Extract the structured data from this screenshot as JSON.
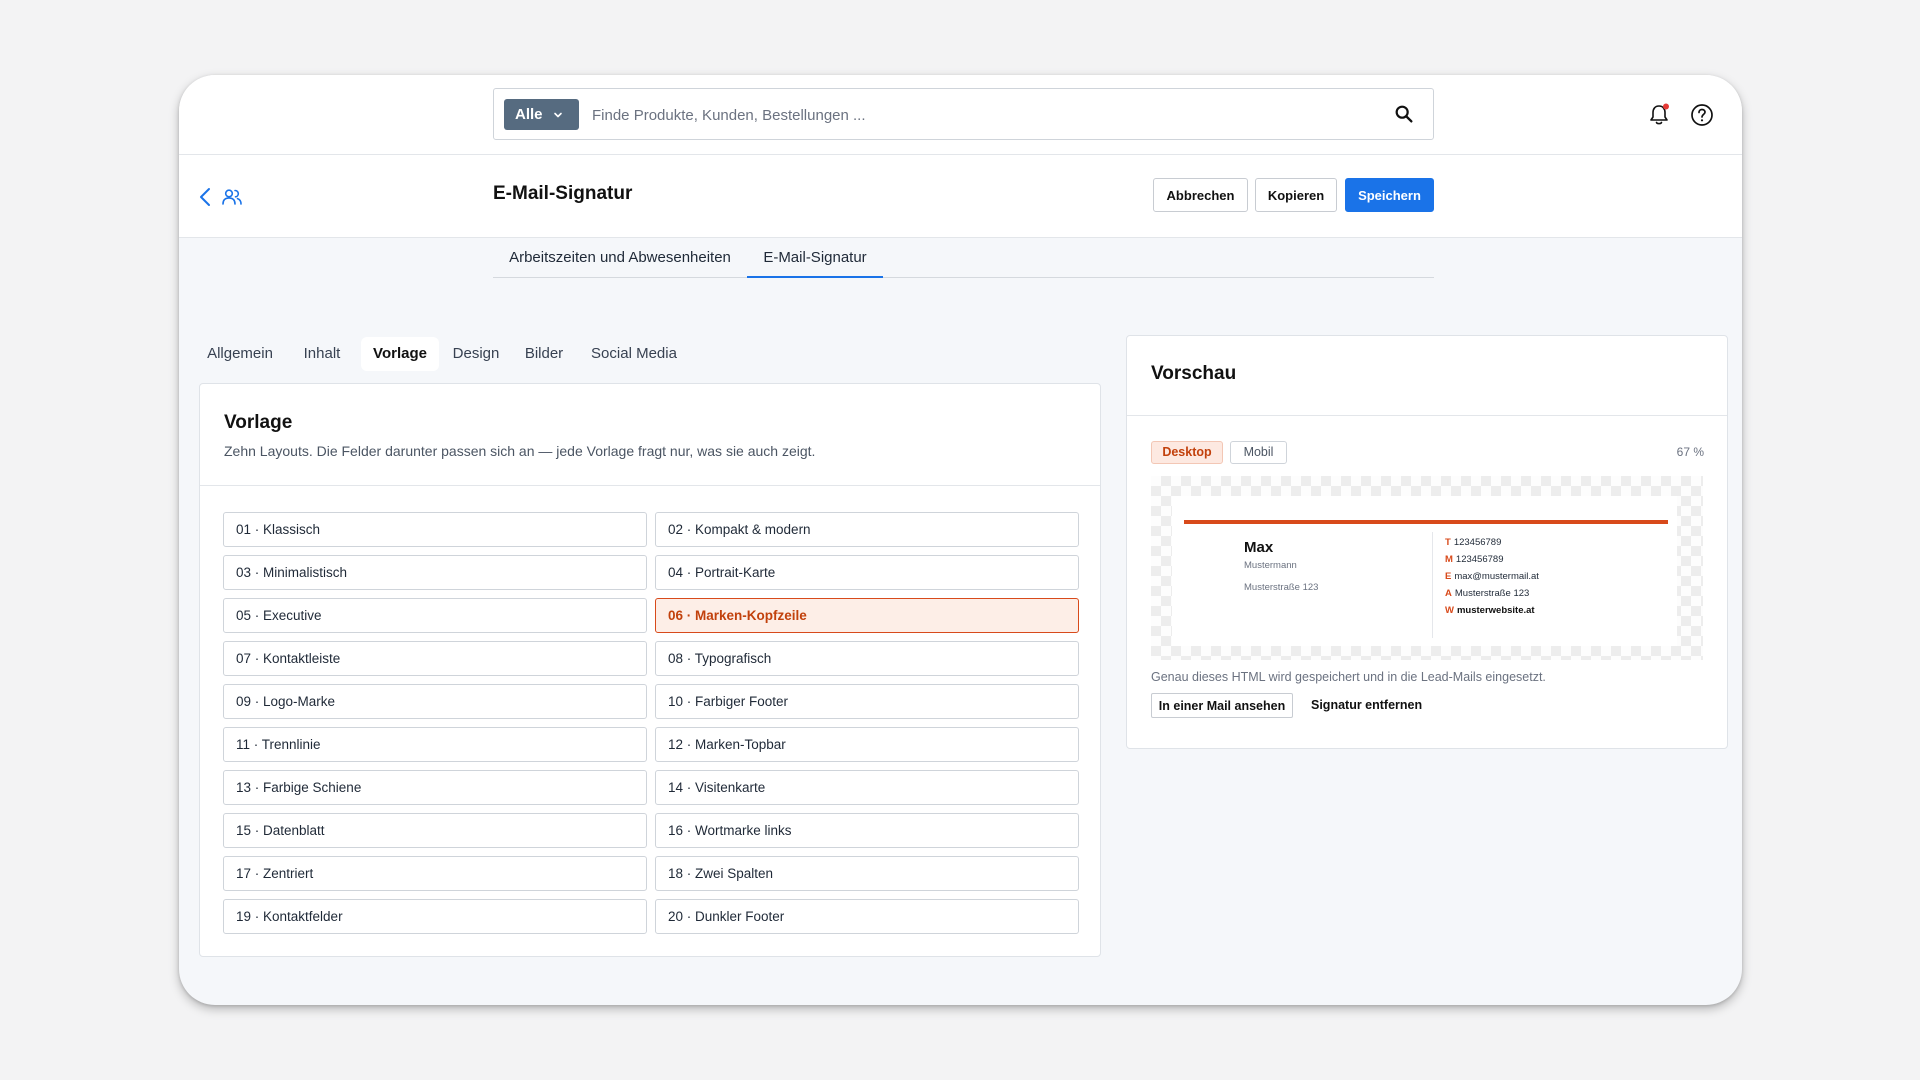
{
  "search": {
    "scope_label": "Alle",
    "placeholder": "Finde Produkte, Kunden, Bestellungen ...",
    "value": ""
  },
  "header": {
    "title": "E-Mail-Signatur",
    "cancel_label": "Abbrechen",
    "copy_label": "Kopieren",
    "save_label": "Speichern"
  },
  "main_tabs": [
    {
      "label": "Arbeitszeiten und Abwesenheiten",
      "active": false
    },
    {
      "label": "E-Mail-Signatur",
      "active": true
    }
  ],
  "sub_tabs": [
    {
      "label": "Allgemein",
      "active": false
    },
    {
      "label": "Inhalt",
      "active": false
    },
    {
      "label": "Vorlage",
      "active": true
    },
    {
      "label": "Design",
      "active": false
    },
    {
      "label": "Bilder",
      "active": false
    },
    {
      "label": "Social Media",
      "active": false
    }
  ],
  "template_panel": {
    "title": "Vorlage",
    "description": "Zehn Layouts. Die Felder darunter passen sich an — jede Vorlage fragt nur, was sie auch zeigt.",
    "selected": "06 · Marken-Kopfzeile",
    "items": [
      "01 · Klassisch",
      "02 · Kompakt & modern",
      "03 · Minimalistisch",
      "04 · Portrait-Karte",
      "05 · Executive",
      "06 · Marken-Kopfzeile",
      "07 · Kontaktleiste",
      "08 · Typografisch",
      "09 · Logo-Marke",
      "10 · Farbiger Footer",
      "11 · Trennlinie",
      "12 · Marken-Topbar",
      "13 · Farbige Schiene",
      "14 · Visitenkarte",
      "15 · Datenblatt",
      "16 · Wortmarke links",
      "17 · Zentriert",
      "18 · Zwei Spalten",
      "19 · Kontaktfelder",
      "20 · Dunkler Footer"
    ]
  },
  "preview": {
    "title": "Vorschau",
    "desktop_label": "Desktop",
    "mobile_label": "Mobil",
    "zoom": "67 %",
    "signature": {
      "name": "Max",
      "surname": "Mustermann",
      "address": "Musterstraße 123",
      "contacts": [
        {
          "key": "T",
          "value": "123456789"
        },
        {
          "key": "M",
          "value": "123456789"
        },
        {
          "key": "E",
          "value": "max@mustermail.at"
        },
        {
          "key": "A",
          "value": "Musterstraße 123"
        },
        {
          "key": "W",
          "value": "musterwebsite.at"
        }
      ]
    },
    "note": "Genau dieses HTML wird gespeichert und in die Lead-Mails eingesetzt.",
    "view_in_mail_label": "In einer Mail ansehen",
    "remove_label": "Signatur entfernen"
  },
  "colors": {
    "accent_blue": "#1a73e8",
    "brand_orange": "#d84a1b",
    "scope_button": "#566b80"
  }
}
